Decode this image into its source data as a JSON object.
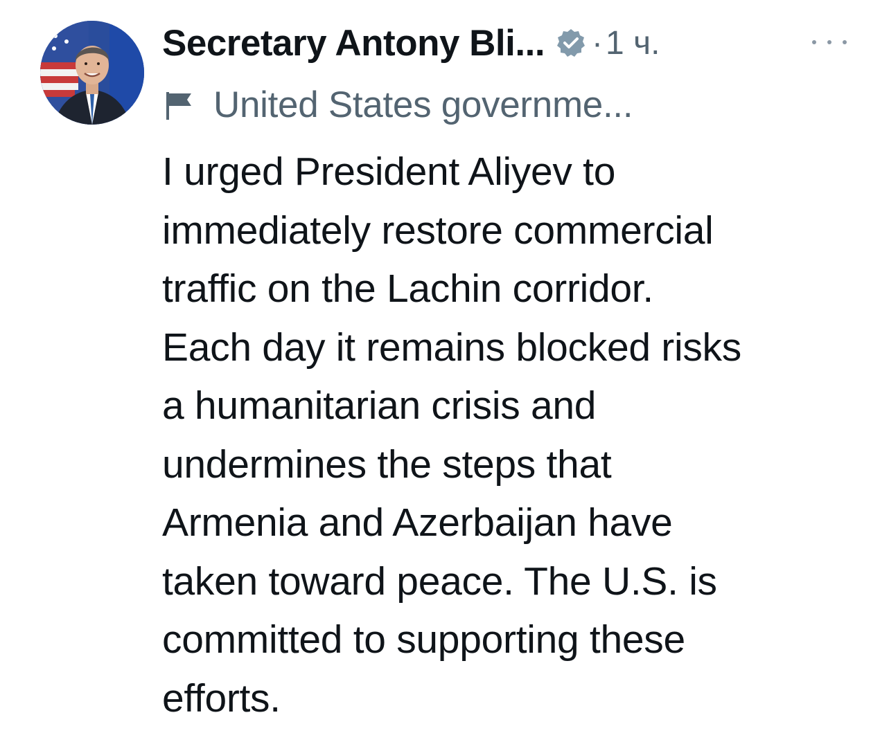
{
  "tweet": {
    "author": {
      "display_name": "Secretary Antony Bli...",
      "avatar_icon": "profile-photo",
      "verified_icon": "verified-badge-icon",
      "verified_color": "#829aab"
    },
    "separator": "·",
    "timestamp": "1 ч.",
    "more_icon": "more-options-icon",
    "affiliation": {
      "icon": "government-flag-icon",
      "label": "United States governme..."
    },
    "text_lines": [
      "I urged President Aliyev to",
      "immediately restore commercial",
      "traffic on the Lachin corridor.",
      "Each day it remains blocked risks",
      "a humanitarian crisis and",
      "undermines the steps that",
      "Armenia and Azerbaijan have",
      "taken toward peace. The U.S. is",
      "committed to supporting these",
      "efforts."
    ]
  },
  "colors": {
    "primary_text": "#0f1419",
    "secondary_text": "#536471",
    "background": "#ffffff"
  }
}
